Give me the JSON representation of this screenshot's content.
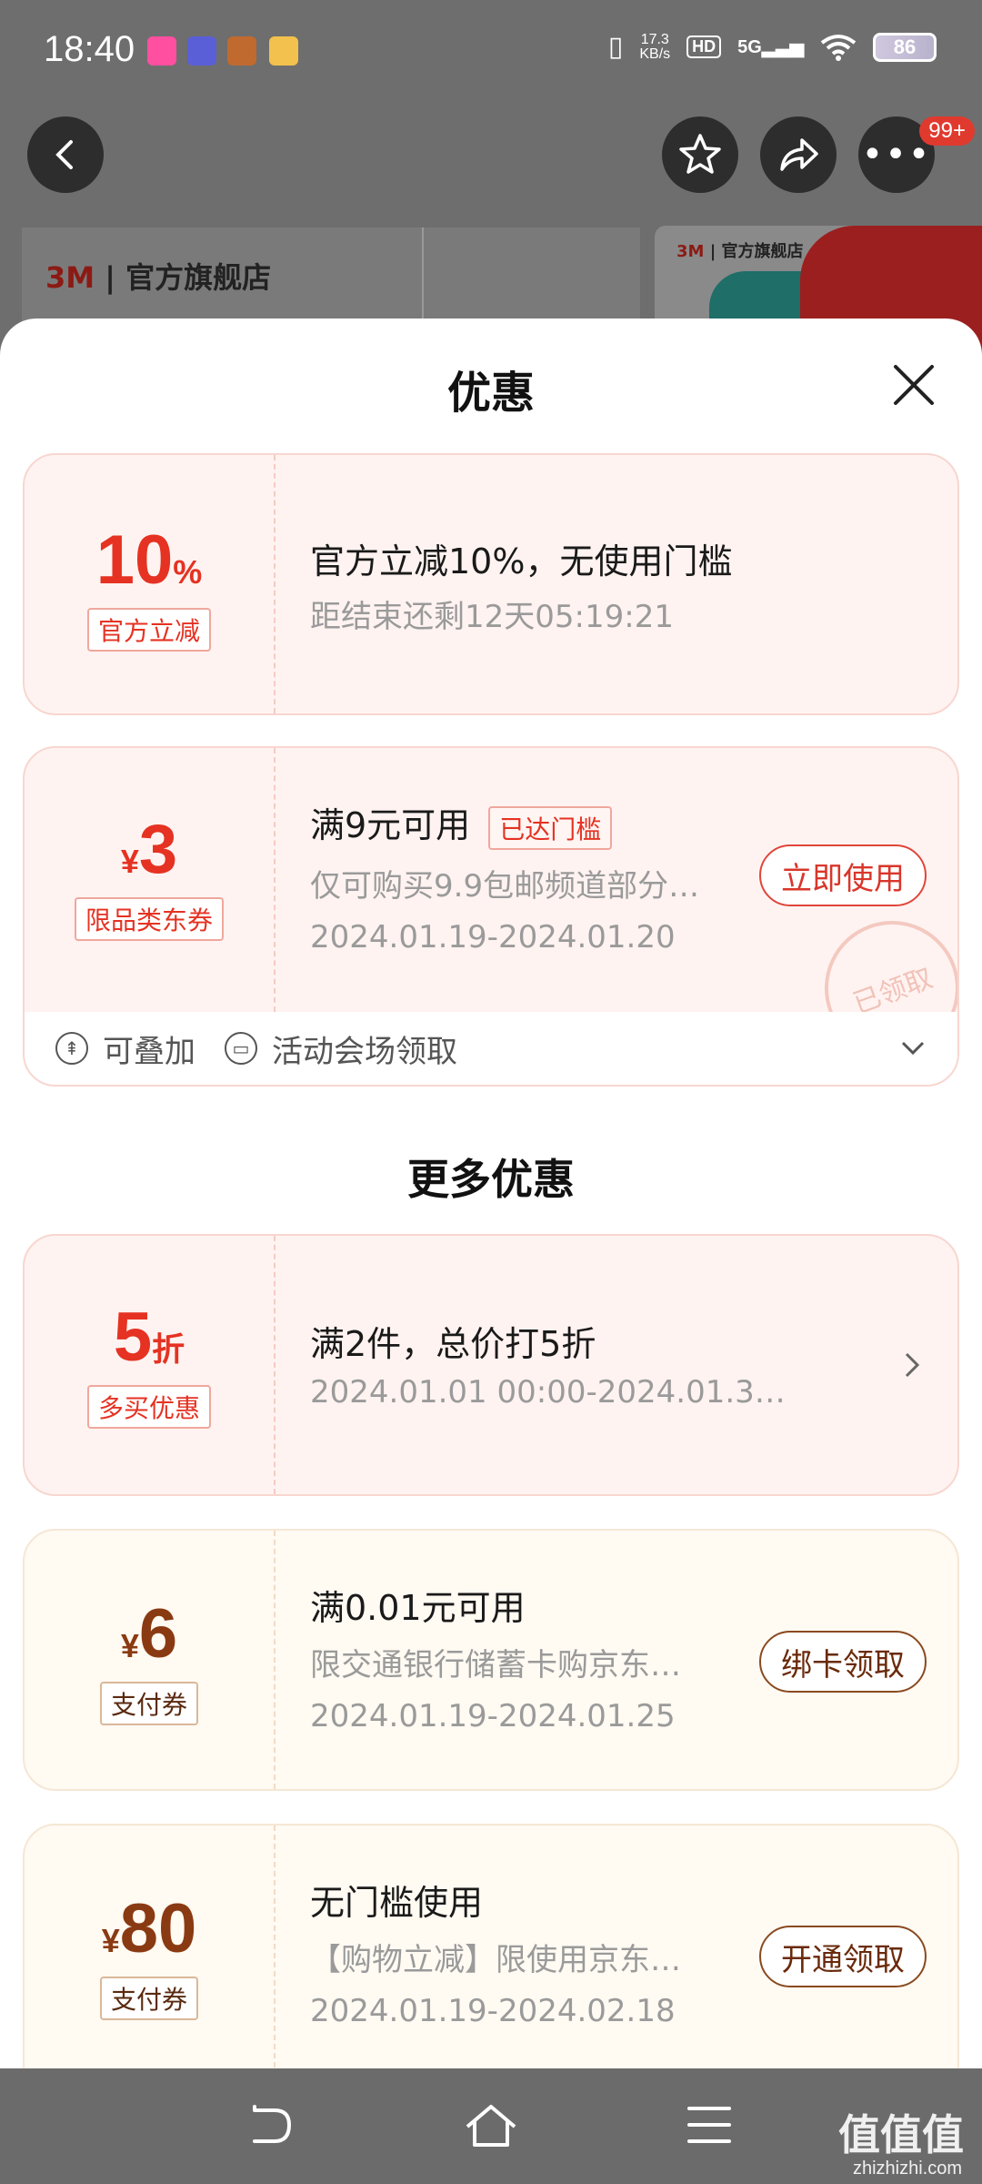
{
  "status_bar": {
    "time": "18:40",
    "speed": "17.3",
    "speed_unit": "KB/s",
    "hd": "HD",
    "network": "5G",
    "battery": "86"
  },
  "header": {
    "badge": "99+"
  },
  "background": {
    "brand": "3M",
    "store": "官方旗舰店"
  },
  "sheet": {
    "title": "优惠",
    "more_title": "更多优惠",
    "coupons": [
      {
        "amount": "10",
        "unit": "%",
        "tag": "官方立减",
        "title": "官方立减10%，无使用门槛",
        "line2": "距结束还剩12天05:19:21"
      },
      {
        "currency": "¥",
        "amount": "3",
        "tag": "限品类东券",
        "title": "满9元可用",
        "reached": "已达门槛",
        "line2": "仅可购买9.9包邮频道部分…",
        "line3": "2024.01.19-2024.01.20",
        "button": "立即使用",
        "stamp": "已领取",
        "footer_stack": "可叠加",
        "footer_source": "活动会场领取"
      }
    ],
    "more": [
      {
        "amount": "5",
        "unit": "折",
        "tag": "多买优惠",
        "title": "满2件，总价打5折",
        "line2": "2024.01.01 00:00-2024.01.3…"
      },
      {
        "currency": "¥",
        "amount": "6",
        "tag": "支付券",
        "title": "满0.01元可用",
        "line2": "限交通银行储蓄卡购京东…",
        "line3": "2024.01.19-2024.01.25",
        "button": "绑卡领取"
      },
      {
        "currency": "¥",
        "amount": "80",
        "tag": "支付券",
        "title": "无门槛使用",
        "line2": "【购物立减】限使用京东…",
        "line3": "2024.01.19-2024.02.18",
        "button": "开通领取"
      }
    ]
  },
  "watermark": {
    "logo": "值值值",
    "site": "zhizhizhi.com"
  }
}
